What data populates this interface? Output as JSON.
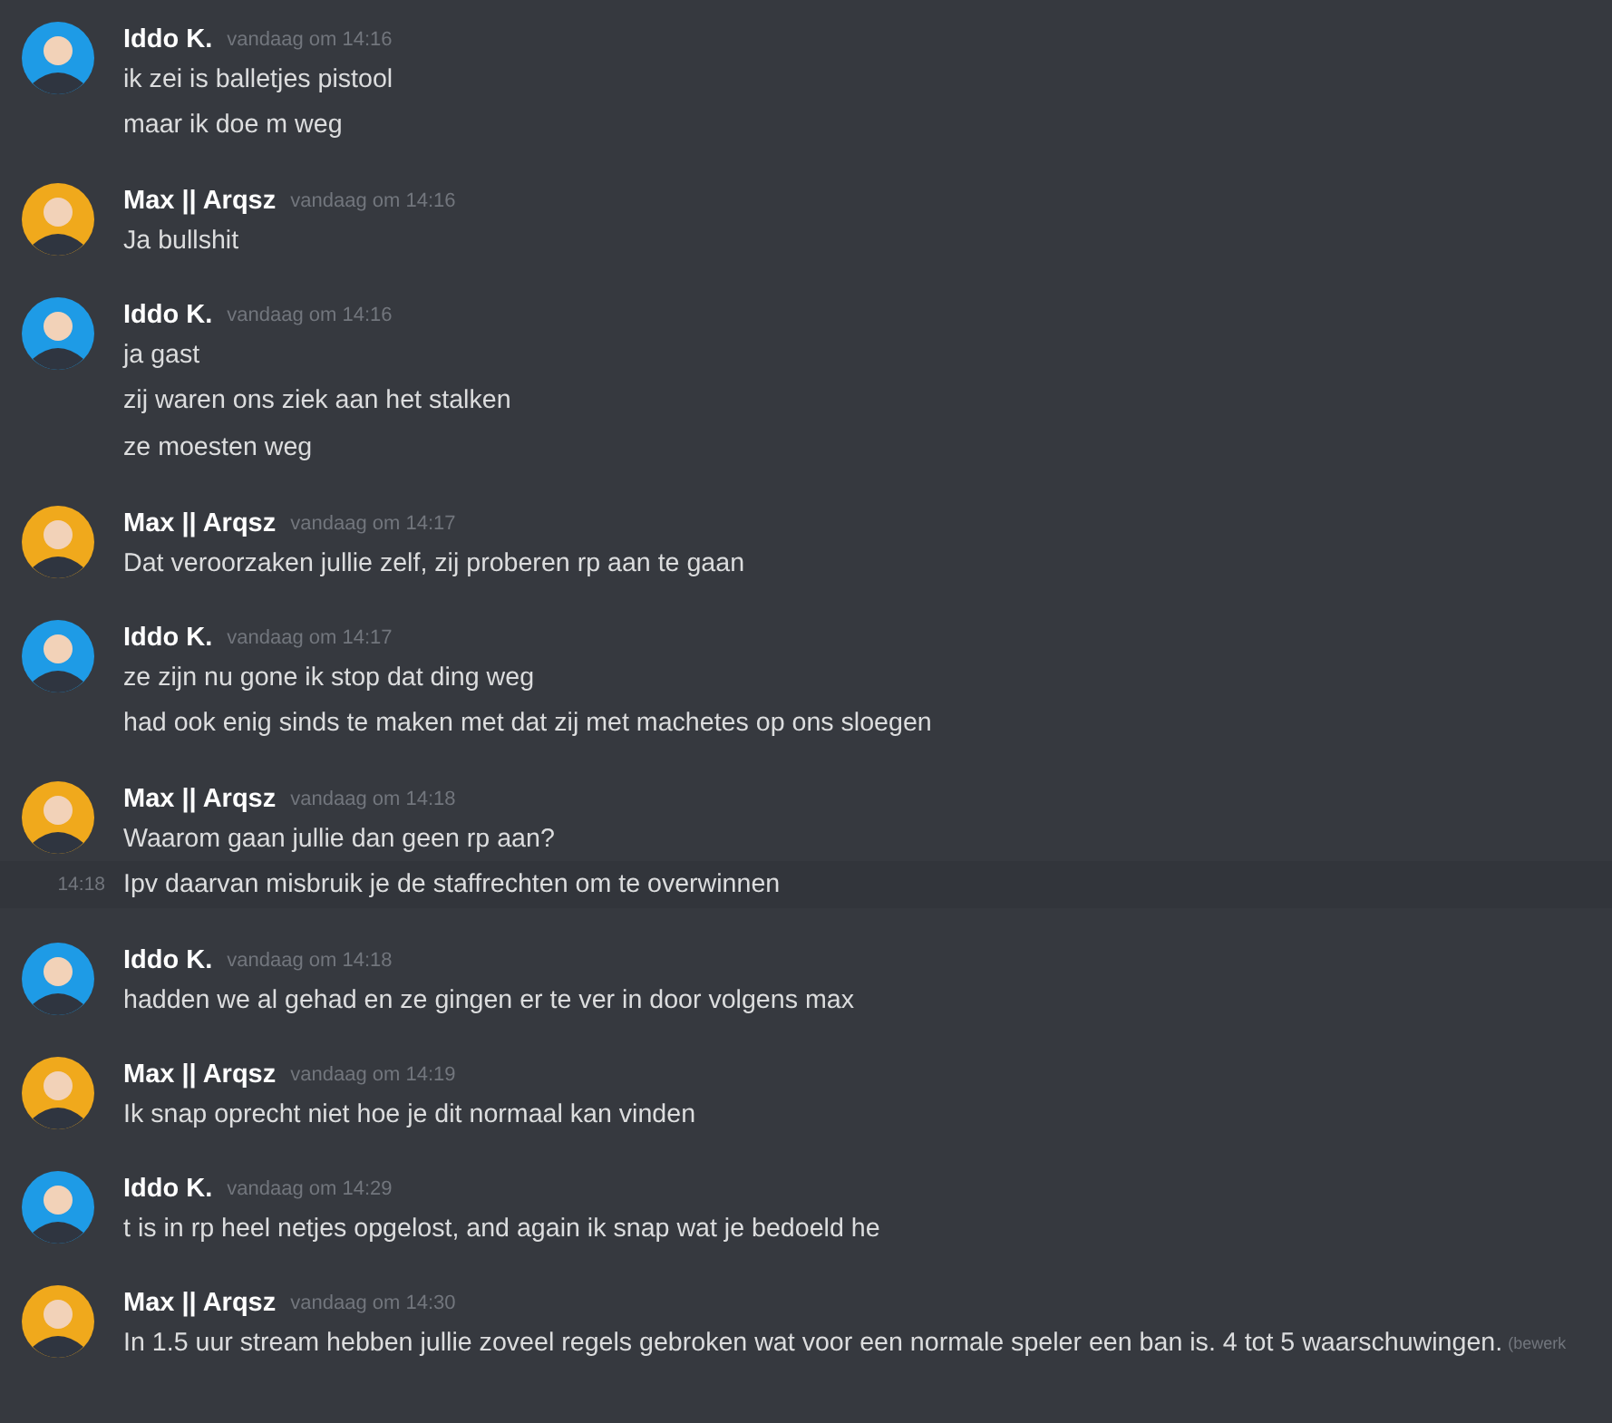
{
  "messages": [
    {
      "author": "Iddo K.",
      "color": "#1e9be6",
      "timestamp": "vandaag om 14:16",
      "lines": [
        {
          "text": "ik zei is balletjes pistool"
        },
        {
          "text": "maar ik doe m weg"
        }
      ]
    },
    {
      "author": "Max || Arqsz",
      "color": "#f0a91c",
      "timestamp": "vandaag om 14:16",
      "lines": [
        {
          "text": "Ja bullshit"
        }
      ]
    },
    {
      "author": "Iddo K.",
      "color": "#1e9be6",
      "timestamp": "vandaag om 14:16",
      "lines": [
        {
          "text": "ja gast"
        },
        {
          "text": "zij waren ons ziek aan het stalken"
        },
        {
          "text": "ze moesten weg"
        }
      ]
    },
    {
      "author": "Max || Arqsz",
      "color": "#f0a91c",
      "timestamp": "vandaag om 14:17",
      "lines": [
        {
          "text": "Dat veroorzaken jullie zelf, zij proberen rp aan te gaan"
        }
      ]
    },
    {
      "author": "Iddo K.",
      "color": "#1e9be6",
      "timestamp": "vandaag om 14:17",
      "lines": [
        {
          "text": "ze zijn nu gone ik stop dat ding weg"
        },
        {
          "text": "had ook enig sinds te maken met dat zij met machetes op ons sloegen"
        }
      ]
    },
    {
      "author": "Max || Arqsz",
      "color": "#f0a91c",
      "timestamp": "vandaag om 14:18",
      "lines": [
        {
          "text": "Waarom gaan jullie dan geen rp aan?"
        },
        {
          "text": "Ipv daarvan misbruik je de staffrechten om te overwinnen",
          "time": "14:18",
          "highlighted": true
        }
      ]
    },
    {
      "author": "Iddo K.",
      "color": "#1e9be6",
      "timestamp": "vandaag om 14:18",
      "lines": [
        {
          "text": "hadden we al gehad en ze gingen er te ver in door volgens max"
        }
      ]
    },
    {
      "author": "Max || Arqsz",
      "color": "#f0a91c",
      "timestamp": "vandaag om 14:19",
      "lines": [
        {
          "text": "Ik snap oprecht niet hoe je dit normaal kan vinden"
        }
      ]
    },
    {
      "author": "Iddo K.",
      "color": "#1e9be6",
      "timestamp": "vandaag om 14:29",
      "lines": [
        {
          "text": "t is in rp heel netjes opgelost, and again ik snap wat je bedoeld he"
        }
      ]
    },
    {
      "author": "Max || Arqsz",
      "color": "#f0a91c",
      "timestamp": "vandaag om 14:30",
      "lines": [
        {
          "text": "In 1.5 uur stream hebben jullie zoveel regels gebroken wat voor een normale speler een ban is. 4 tot 5 waarschuwingen.",
          "edited": "(bewerk"
        }
      ]
    }
  ]
}
